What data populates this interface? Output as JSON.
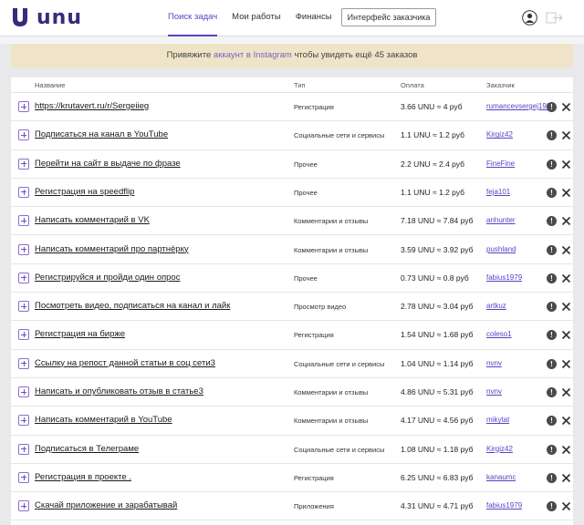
{
  "brand": {
    "name": "unu",
    "accent": "#5b3fc4"
  },
  "nav": {
    "items": [
      {
        "label": "Поиск задач",
        "active": true
      },
      {
        "label": "Мои работы",
        "active": false
      },
      {
        "label": "Финансы",
        "active": false
      }
    ],
    "client_button": "Интерфейс заказчика",
    "user_icon": "user-icon",
    "logout_icon": "logout-icon"
  },
  "banner": {
    "text_before": "Привяжите",
    "link": "аккаунт в Instagram",
    "text_after": "чтобы увидеть ещё 45 заказов"
  },
  "table": {
    "headers": {
      "name": "Название",
      "type": "Тип",
      "pay": "Оплата",
      "customer": "Заказчик"
    },
    "rows": [
      {
        "name": "https://krutavert.ru/r/Sergeiieg",
        "type": "Регистрация",
        "pay": "3.66 UNU ≈ 4 руб",
        "customer": "rumancevsergej1992"
      },
      {
        "name": "Подписаться на канал в YouTube",
        "type": "Социальные сети и сервисы",
        "pay": "1.1 UNU ≈ 1.2 руб",
        "customer": "Kirgiz42"
      },
      {
        "name": "Перейти на сайт в выдаче по фразе",
        "type": "Прочее",
        "pay": "2.2 UNU ≈ 2.4 руб",
        "customer": "FineFine"
      },
      {
        "name": "Регистрация на speedflip",
        "type": "Прочее",
        "pay": "1.1 UNU ≈ 1.2 руб",
        "customer": "feja101"
      },
      {
        "name": "Написать комментарий в VK",
        "type": "Комментарии и отзывы",
        "pay": "7.18 UNU ≈ 7.84 руб",
        "customer": "anhunter"
      },
      {
        "name": "Написать комментарий про партнёрку",
        "type": "Комментарии и отзывы",
        "pay": "3.59 UNU ≈ 3.92 руб",
        "customer": "pushland"
      },
      {
        "name": "Регистрируйся и пройди один опрос",
        "type": "Прочее",
        "pay": "0.73 UNU ≈ 0.8 руб",
        "customer": "fabius1979"
      },
      {
        "name": "Посмотреть видео, подписаться на канал и лайк",
        "type": "Просмотр видео",
        "pay": "2.78 UNU ≈ 3.04 руб",
        "customer": "artkuz"
      },
      {
        "name": "Регистрация на бирже",
        "type": "Регистрация",
        "pay": "1.54 UNU ≈ 1.68 руб",
        "customer": "coleso1"
      },
      {
        "name": "Ссылку на репост данной статьи в соц сети3",
        "type": "Социальные сети и сервисы",
        "pay": "1.04 UNU ≈ 1.14 руб",
        "customer": "nvnv"
      },
      {
        "name": "Написать и опубликовать отзыв в статье3",
        "type": "Комментарии и отзывы",
        "pay": "4.86 UNU ≈ 5.31 руб",
        "customer": "nvnv"
      },
      {
        "name": "Написать комментарий в YouTube",
        "type": "Комментарии и отзывы",
        "pay": "4.17 UNU ≈ 4.56 руб",
        "customer": "mikytat"
      },
      {
        "name": "Подписаться в Телеграме",
        "type": "Социальные сети и сервисы",
        "pay": "1.08 UNU ≈ 1.18 руб",
        "customer": "Kirgiz42"
      },
      {
        "name": "Регистрация в проекте .",
        "type": "Регистрация",
        "pay": "6.25 UNU ≈ 6.83 руб",
        "customer": "kanaumc"
      },
      {
        "name": "Скачай приложение и зарабатывай",
        "type": "Приложения",
        "pay": "4.31 UNU ≈ 4.71 руб",
        "customer": "fabius1979"
      }
    ],
    "info_icon": "info-icon",
    "close_icon": "close-icon"
  }
}
